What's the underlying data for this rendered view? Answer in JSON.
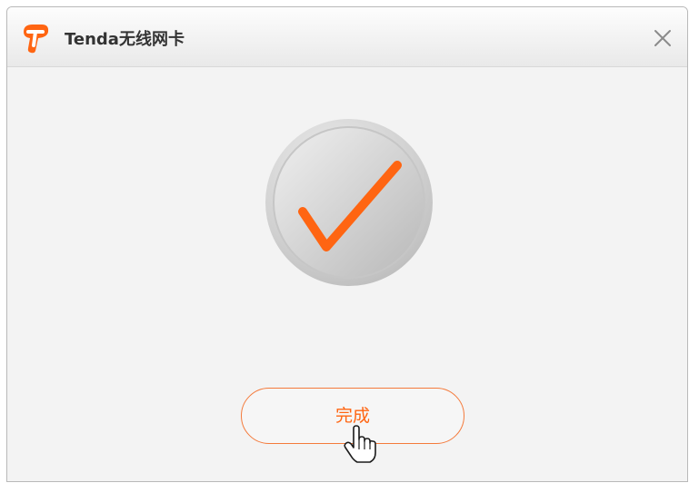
{
  "window": {
    "title": "Tenda无线网卡",
    "logo_icon": "tenda-t-logo-icon",
    "close_icon": "close-icon"
  },
  "main": {
    "status_icon": "checkmark-success-icon",
    "done_button_label": "完成"
  },
  "colors": {
    "accent": "#ff6512",
    "title_text": "#333333",
    "window_bg": "#f3f3f3"
  }
}
